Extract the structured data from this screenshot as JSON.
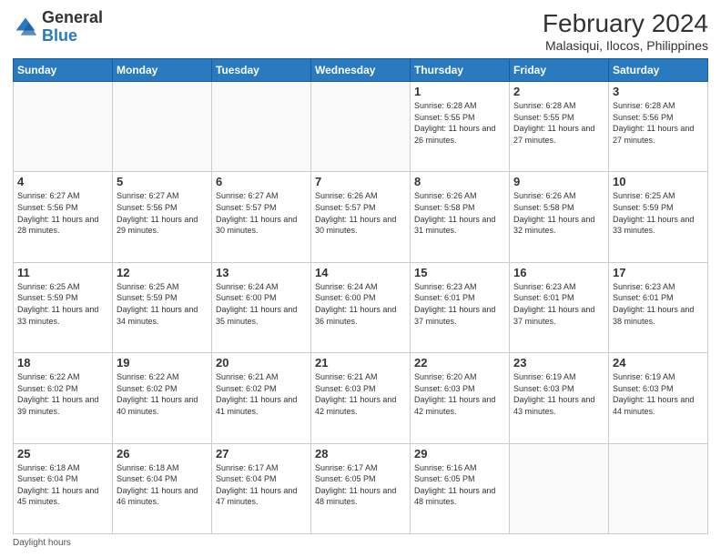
{
  "header": {
    "logo_general": "General",
    "logo_blue": "Blue",
    "month_year": "February 2024",
    "location": "Malasiqui, Ilocos, Philippines"
  },
  "days_of_week": [
    "Sunday",
    "Monday",
    "Tuesday",
    "Wednesday",
    "Thursday",
    "Friday",
    "Saturday"
  ],
  "weeks": [
    [
      {
        "day": "",
        "sunrise": "",
        "sunset": "",
        "daylight": ""
      },
      {
        "day": "",
        "sunrise": "",
        "sunset": "",
        "daylight": ""
      },
      {
        "day": "",
        "sunrise": "",
        "sunset": "",
        "daylight": ""
      },
      {
        "day": "",
        "sunrise": "",
        "sunset": "",
        "daylight": ""
      },
      {
        "day": "1",
        "sunrise": "Sunrise: 6:28 AM",
        "sunset": "Sunset: 5:55 PM",
        "daylight": "Daylight: 11 hours and 26 minutes."
      },
      {
        "day": "2",
        "sunrise": "Sunrise: 6:28 AM",
        "sunset": "Sunset: 5:55 PM",
        "daylight": "Daylight: 11 hours and 27 minutes."
      },
      {
        "day": "3",
        "sunrise": "Sunrise: 6:28 AM",
        "sunset": "Sunset: 5:56 PM",
        "daylight": "Daylight: 11 hours and 27 minutes."
      }
    ],
    [
      {
        "day": "4",
        "sunrise": "Sunrise: 6:27 AM",
        "sunset": "Sunset: 5:56 PM",
        "daylight": "Daylight: 11 hours and 28 minutes."
      },
      {
        "day": "5",
        "sunrise": "Sunrise: 6:27 AM",
        "sunset": "Sunset: 5:56 PM",
        "daylight": "Daylight: 11 hours and 29 minutes."
      },
      {
        "day": "6",
        "sunrise": "Sunrise: 6:27 AM",
        "sunset": "Sunset: 5:57 PM",
        "daylight": "Daylight: 11 hours and 30 minutes."
      },
      {
        "day": "7",
        "sunrise": "Sunrise: 6:26 AM",
        "sunset": "Sunset: 5:57 PM",
        "daylight": "Daylight: 11 hours and 30 minutes."
      },
      {
        "day": "8",
        "sunrise": "Sunrise: 6:26 AM",
        "sunset": "Sunset: 5:58 PM",
        "daylight": "Daylight: 11 hours and 31 minutes."
      },
      {
        "day": "9",
        "sunrise": "Sunrise: 6:26 AM",
        "sunset": "Sunset: 5:58 PM",
        "daylight": "Daylight: 11 hours and 32 minutes."
      },
      {
        "day": "10",
        "sunrise": "Sunrise: 6:25 AM",
        "sunset": "Sunset: 5:59 PM",
        "daylight": "Daylight: 11 hours and 33 minutes."
      }
    ],
    [
      {
        "day": "11",
        "sunrise": "Sunrise: 6:25 AM",
        "sunset": "Sunset: 5:59 PM",
        "daylight": "Daylight: 11 hours and 33 minutes."
      },
      {
        "day": "12",
        "sunrise": "Sunrise: 6:25 AM",
        "sunset": "Sunset: 5:59 PM",
        "daylight": "Daylight: 11 hours and 34 minutes."
      },
      {
        "day": "13",
        "sunrise": "Sunrise: 6:24 AM",
        "sunset": "Sunset: 6:00 PM",
        "daylight": "Daylight: 11 hours and 35 minutes."
      },
      {
        "day": "14",
        "sunrise": "Sunrise: 6:24 AM",
        "sunset": "Sunset: 6:00 PM",
        "daylight": "Daylight: 11 hours and 36 minutes."
      },
      {
        "day": "15",
        "sunrise": "Sunrise: 6:23 AM",
        "sunset": "Sunset: 6:01 PM",
        "daylight": "Daylight: 11 hours and 37 minutes."
      },
      {
        "day": "16",
        "sunrise": "Sunrise: 6:23 AM",
        "sunset": "Sunset: 6:01 PM",
        "daylight": "Daylight: 11 hours and 37 minutes."
      },
      {
        "day": "17",
        "sunrise": "Sunrise: 6:23 AM",
        "sunset": "Sunset: 6:01 PM",
        "daylight": "Daylight: 11 hours and 38 minutes."
      }
    ],
    [
      {
        "day": "18",
        "sunrise": "Sunrise: 6:22 AM",
        "sunset": "Sunset: 6:02 PM",
        "daylight": "Daylight: 11 hours and 39 minutes."
      },
      {
        "day": "19",
        "sunrise": "Sunrise: 6:22 AM",
        "sunset": "Sunset: 6:02 PM",
        "daylight": "Daylight: 11 hours and 40 minutes."
      },
      {
        "day": "20",
        "sunrise": "Sunrise: 6:21 AM",
        "sunset": "Sunset: 6:02 PM",
        "daylight": "Daylight: 11 hours and 41 minutes."
      },
      {
        "day": "21",
        "sunrise": "Sunrise: 6:21 AM",
        "sunset": "Sunset: 6:03 PM",
        "daylight": "Daylight: 11 hours and 42 minutes."
      },
      {
        "day": "22",
        "sunrise": "Sunrise: 6:20 AM",
        "sunset": "Sunset: 6:03 PM",
        "daylight": "Daylight: 11 hours and 42 minutes."
      },
      {
        "day": "23",
        "sunrise": "Sunrise: 6:19 AM",
        "sunset": "Sunset: 6:03 PM",
        "daylight": "Daylight: 11 hours and 43 minutes."
      },
      {
        "day": "24",
        "sunrise": "Sunrise: 6:19 AM",
        "sunset": "Sunset: 6:03 PM",
        "daylight": "Daylight: 11 hours and 44 minutes."
      }
    ],
    [
      {
        "day": "25",
        "sunrise": "Sunrise: 6:18 AM",
        "sunset": "Sunset: 6:04 PM",
        "daylight": "Daylight: 11 hours and 45 minutes."
      },
      {
        "day": "26",
        "sunrise": "Sunrise: 6:18 AM",
        "sunset": "Sunset: 6:04 PM",
        "daylight": "Daylight: 11 hours and 46 minutes."
      },
      {
        "day": "27",
        "sunrise": "Sunrise: 6:17 AM",
        "sunset": "Sunset: 6:04 PM",
        "daylight": "Daylight: 11 hours and 47 minutes."
      },
      {
        "day": "28",
        "sunrise": "Sunrise: 6:17 AM",
        "sunset": "Sunset: 6:05 PM",
        "daylight": "Daylight: 11 hours and 48 minutes."
      },
      {
        "day": "29",
        "sunrise": "Sunrise: 6:16 AM",
        "sunset": "Sunset: 6:05 PM",
        "daylight": "Daylight: 11 hours and 48 minutes."
      },
      {
        "day": "",
        "sunrise": "",
        "sunset": "",
        "daylight": ""
      },
      {
        "day": "",
        "sunrise": "",
        "sunset": "",
        "daylight": ""
      }
    ]
  ],
  "footer": {
    "label": "Daylight hours"
  }
}
